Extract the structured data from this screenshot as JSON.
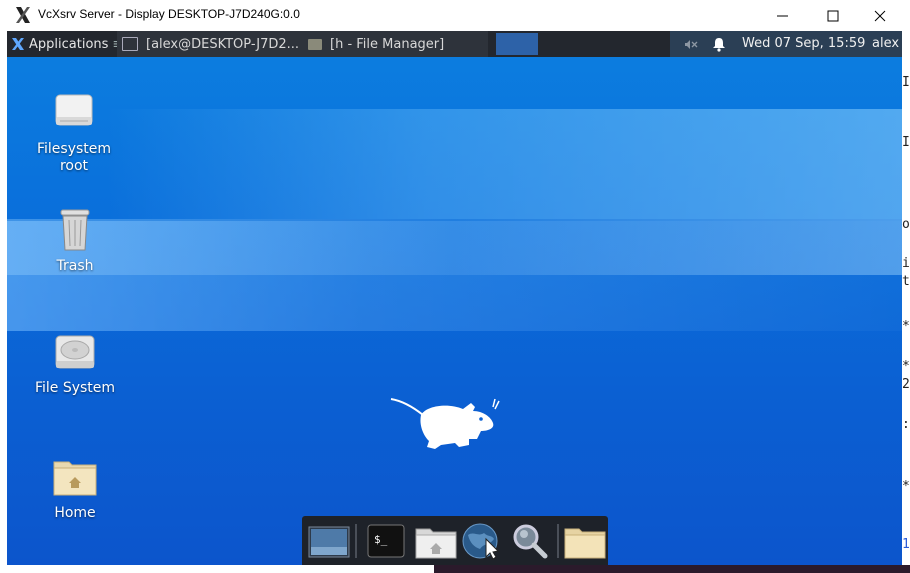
{
  "host_window": {
    "title": "VcXsrv Server - Display DESKTOP-J7D240G:0.0",
    "icon": "x-logo-icon",
    "controls": [
      "minimize-icon",
      "maximize-icon",
      "close-icon"
    ]
  },
  "background_terminal": {
    "chars": [
      "I",
      "I",
      "o",
      "i",
      "t",
      "*",
      "*",
      "2",
      ":",
      "*",
      "1"
    ]
  },
  "panel": {
    "applications_label": "Applications",
    "applications_separator": "≡",
    "tasks": [
      {
        "label": "[alex@DESKTOP-J7D2...",
        "icon": "terminal-icon"
      },
      {
        "label": "[h - File Manager]",
        "icon": "folder-icon"
      }
    ],
    "clock": "Wed 07 Sep, 15:59",
    "user": "alex",
    "tray_icons": [
      "muted-speaker-icon",
      "notification-bell-icon"
    ]
  },
  "desktop_icons": [
    {
      "label_line1": "Filesystem",
      "label_line2": "root",
      "icon": "drive-icon"
    },
    {
      "label_line1": "Trash",
      "label_line2": "",
      "icon": "trash-icon"
    },
    {
      "label_line1": "File System",
      "label_line2": "",
      "icon": "hard-disk-icon"
    },
    {
      "label_line1": "Home",
      "label_line2": "",
      "icon": "home-folder-icon"
    }
  ],
  "dock": {
    "items": [
      "show-desktop-icon",
      "terminal-icon",
      "home-folder-icon",
      "web-browser-icon",
      "search-icon",
      "folder-icon"
    ]
  },
  "colors": {
    "panel": "#23272e",
    "desktop": "#0a6fdb",
    "tray": "#2b3f55",
    "workspace_active": "#2d62a8"
  }
}
